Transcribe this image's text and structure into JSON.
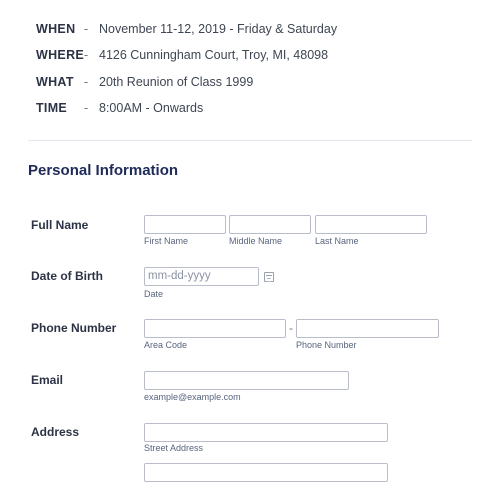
{
  "event": {
    "rows": [
      {
        "key": "WHEN",
        "sep": "-",
        "value": "November 11-12, 2019 - Friday & Saturday"
      },
      {
        "key": "WHERE",
        "sep": "-",
        "value": "4126 Cunningham Court, Troy, MI, 48098"
      },
      {
        "key": "WHAT",
        "sep": "-",
        "value": "20th Reunion of Class 1999"
      },
      {
        "key": "TIME",
        "sep": "-",
        "value": "8:00AM - Onwards"
      }
    ]
  },
  "section": {
    "title": "Personal Information"
  },
  "form": {
    "full_name": {
      "label": "Full Name",
      "first_sub": "First Name",
      "middle_sub": "Middle Name",
      "last_sub": "Last Name"
    },
    "dob": {
      "label": "Date of Birth",
      "placeholder": "mm-dd-yyyy",
      "sub": "Date",
      "icon": "calendar-icon"
    },
    "phone": {
      "label": "Phone Number",
      "separator": "-",
      "area_sub": "Area Code",
      "number_sub": "Phone Number"
    },
    "email": {
      "label": "Email",
      "sub": "example@example.com"
    },
    "address": {
      "label": "Address",
      "street_sub": "Street Address"
    }
  }
}
